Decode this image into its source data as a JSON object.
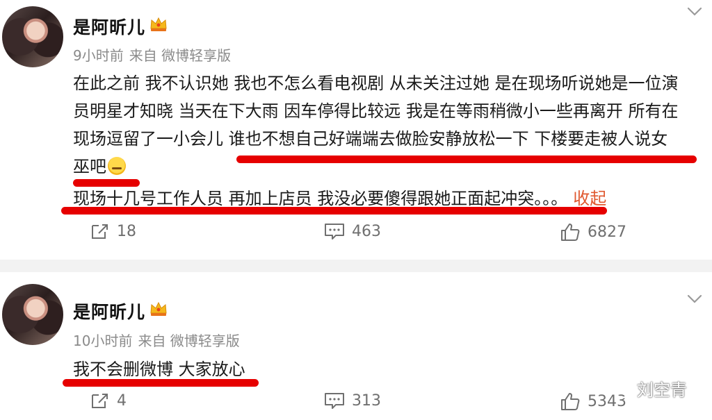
{
  "posts": [
    {
      "username": "是阿昕儿",
      "time": "9小时前",
      "source": "来自 微博轻享版",
      "content_lines": [
        "在此之前 我不认识她 我也不怎么看电视剧 从未关注过她 是在现场听说她是一位演",
        "员明星才知晓 当天在下大雨 因车停得比较远 我是在等雨稍微小一些再离开 所有在",
        "现场逗留了一小会儿 谁也不想自己好端端去做脸安静放松一下 下楼要走被人说女",
        "巫吧",
        "现场十几号工作人员 再加上店员 我没必要傻得跟她正面起冲突。。。"
      ],
      "collapse_label": "收起",
      "reposts": "18",
      "comments": "463",
      "likes": "6827"
    },
    {
      "username": "是阿昕儿",
      "time": "10小时前",
      "source": "来自 微博轻享版",
      "content_lines": [
        "我不会删微博 大家放心"
      ],
      "reposts": "4",
      "comments": "313",
      "likes": "5343"
    }
  ],
  "watermark": "刘空青",
  "colors": {
    "underline": "#e60000",
    "collapse": "#e0582f",
    "meta": "#8a8a8a",
    "divider": "#f2f2f2"
  }
}
